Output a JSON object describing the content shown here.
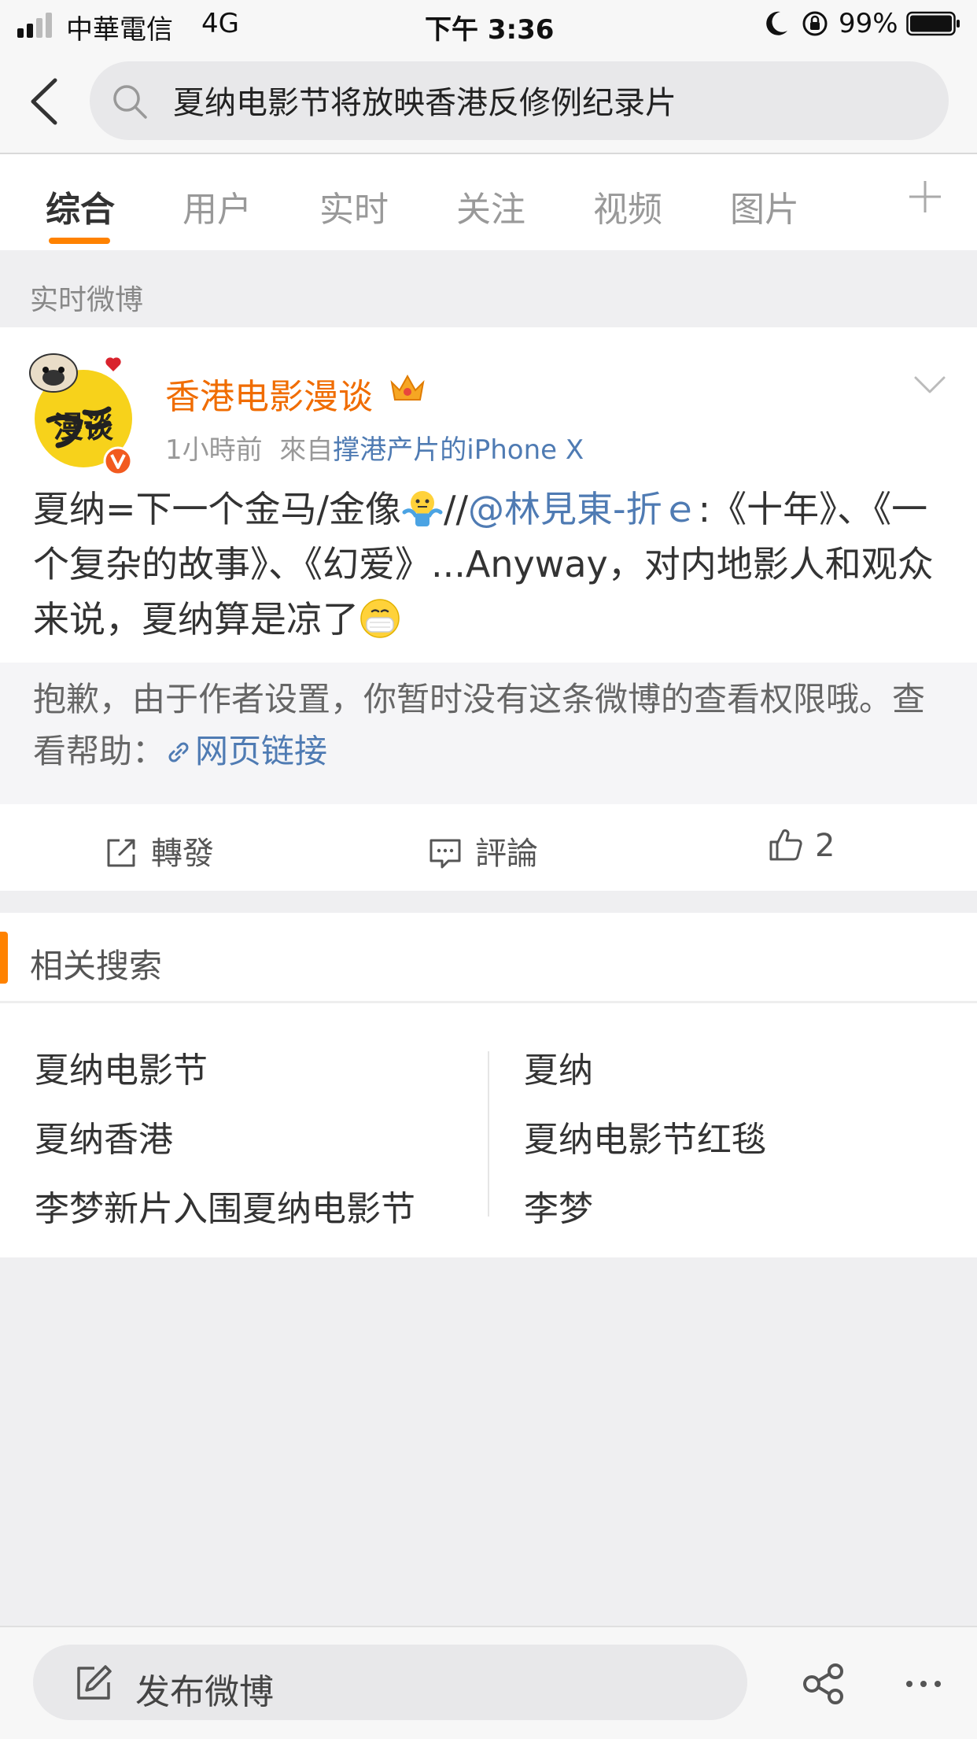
{
  "status_bar": {
    "carrier": "中華電信",
    "network": "4G",
    "time": "下午 3:36",
    "battery": "99%"
  },
  "search": {
    "query": "夏纳电影节将放映香港反修例纪录片"
  },
  "tabs": [
    {
      "label": "综合"
    },
    {
      "label": "用户"
    },
    {
      "label": "实时"
    },
    {
      "label": "关注"
    },
    {
      "label": "视频"
    },
    {
      "label": "图片"
    }
  ],
  "section_label": "实时微博",
  "post": {
    "avatar_text": "漫谈",
    "username": "香港电影漫谈",
    "time": "1小時前",
    "source_prefix": "來自",
    "source": "撑港产片的iPhone X",
    "text_part1": "夏纳=下一个金马/金像",
    "text_part2": "//",
    "mention": "@林見東-折ｅ",
    "text_part3": ":《十年》、《一个复杂的故事》、《幻爱》...Anyway，对内地影人和观众来说，夏纳算是凉了",
    "notice_text": "抱歉，由于作者设置，你暂时没有这条微博的查看权限哦。查看帮助：",
    "notice_link": "网页链接",
    "actions": {
      "repost": "轉發",
      "comment": "評論",
      "like_count": "2"
    }
  },
  "related": {
    "title": "相关搜索",
    "items": [
      "夏纳电影节",
      "夏纳",
      "夏纳香港",
      "夏纳电影节红毯",
      "李梦新片入围夏纳电影节",
      "李梦"
    ]
  },
  "bottom_bar": {
    "compose_label": "发布微博"
  },
  "colors": {
    "accent": "#ff8200",
    "username": "#f06c00",
    "link": "#4f7bb3"
  }
}
